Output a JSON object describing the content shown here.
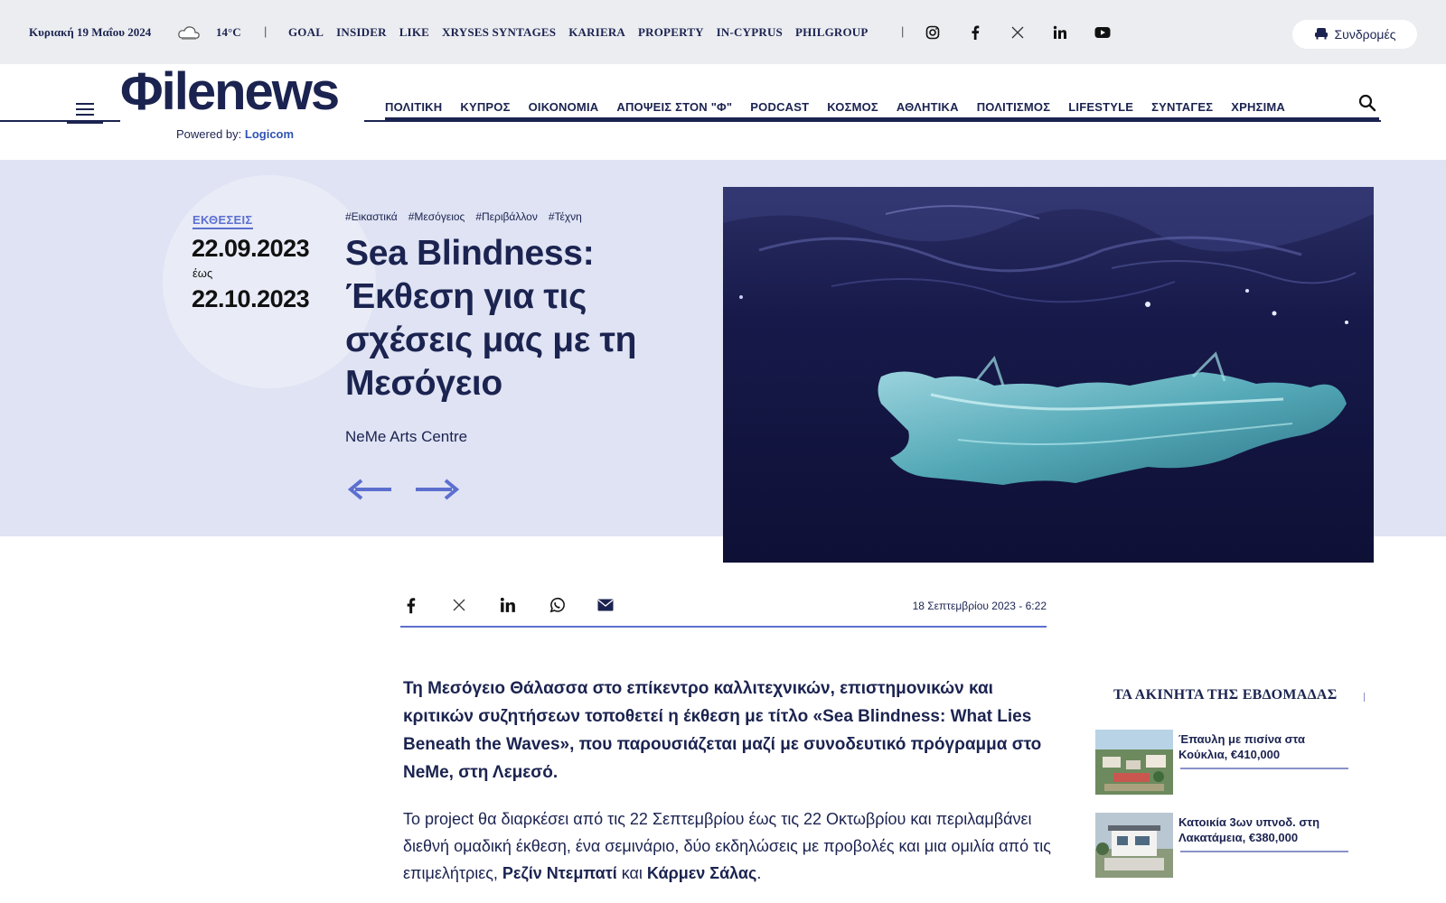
{
  "topbar": {
    "date": "Κυριακή 19 Μαΐου 2024",
    "weather_icon": "cloud-icon",
    "temperature": "14°C",
    "separator": "|",
    "links": [
      "GOAL",
      "INSIDER",
      "LIKE",
      "XRYSES SYNTAGES",
      "KARIERA",
      "PROPERTY",
      "IN-CYPRUS",
      "PHILGROUP"
    ],
    "social_icons": [
      "instagram-icon",
      "facebook-icon",
      "x-icon",
      "linkedin-icon",
      "youtube-icon"
    ],
    "subscribe_label": "Συνδρομές"
  },
  "header": {
    "logo_text": "Φilenews",
    "powered_by": "Powered by:",
    "powered_brand": "Logicom",
    "nav": [
      "ΠΟΛΙΤΙΚΗ",
      "ΚΥΠΡΟΣ",
      "ΟΙΚΟΝΟΜΙΑ",
      "ΑΠΟΨΕΙΣ ΣΤΟΝ \"Φ\"",
      "PODCAST",
      "ΚΟΣΜΟΣ",
      "ΑΘΛΗΤΙΚΑ",
      "ΠΟΛΙΤΙΣΜΟΣ",
      "LIFESTYLE",
      "ΣΥΝΤΑΓΕΣ",
      "ΧΡΗΣΙΜΑ"
    ]
  },
  "hero": {
    "category": "ΕΚΘΕΣΕΙΣ",
    "date_from": "22.09.2023",
    "until": "έως",
    "date_to": "22.10.2023",
    "tags": [
      "#Εικαστικά",
      "#Μεσόγειος",
      "#Περιβάλλον",
      "#Τέχνη"
    ],
    "title": "Sea Blindness: Έκθεση για τις σχέσεις μας με τη Μεσόγειο",
    "venue": "NeMe Arts Centre"
  },
  "share": {
    "icons": [
      "facebook-icon",
      "x-icon",
      "linkedin-icon",
      "whatsapp-icon",
      "email-icon"
    ],
    "published": "18 Σεπτεμβρίου 2023 - 6:22"
  },
  "article": {
    "lead": "Τη Μεσόγειο Θάλασσα στο επίκεντρο καλλιτεχνικών, επιστημονικών και κριτικών συζητήσεων τοποθετεί η έκθεση με τίτλο «Sea Blindness: What Lies Beneath the Waves», που παρουσιάζεται μαζί με συνοδευτικό πρόγραμμα στο NeMe, στη Λεμεσό.",
    "body_start": "Το project θα διαρκέσει από τις 22 Σεπτεμβρίου έως τις 22 Οκτωβρίου και περιλαμβάνει διεθνή ομαδική έκθεση, ένα σεμινάριο, δύο εκδηλώσεις με προβολές και μια ομιλία από τις επιμελήτριες, ",
    "curator1": "Ρεζίν Ντεμπατί",
    "and": " και ",
    "curator2": "Κάρμεν Σάλας",
    "end": "."
  },
  "sidebar": {
    "title": "ΤΑ ΑΚΙΝΗΤΑ ΤΗΣ ΕΒΔΟΜΑΔΑΣ",
    "items": [
      {
        "label": "Έπαυλη με πισίνα στα Κούκλια, €410,000"
      },
      {
        "label": "Κατοικία 3ων υπνοδ. στη Λακατάμεια, €380,000"
      }
    ]
  },
  "colors": {
    "navy": "#1b2350",
    "accent": "#5c6fcf",
    "hero_bg": "#dfe3f3",
    "topbar_bg": "#ecedf1"
  }
}
